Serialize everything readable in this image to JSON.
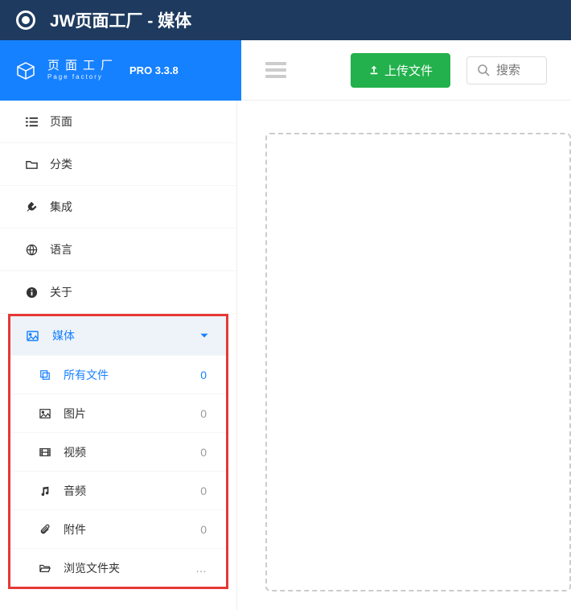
{
  "header": {
    "title": "JW页面工厂 - 媒体"
  },
  "brand": {
    "name_cn": "页面工厂",
    "name_en": "Page factory",
    "version": "PRO 3.3.8"
  },
  "toolbar": {
    "upload_label": "上传文件",
    "search_placeholder": "搜索"
  },
  "nav": {
    "items": [
      {
        "label": "页面"
      },
      {
        "label": "分类"
      },
      {
        "label": "集成"
      },
      {
        "label": "语言"
      },
      {
        "label": "关于"
      }
    ]
  },
  "media": {
    "header": "媒体",
    "items": [
      {
        "label": "所有文件",
        "count": "0",
        "active": true
      },
      {
        "label": "图片",
        "count": "0"
      },
      {
        "label": "视频",
        "count": "0"
      },
      {
        "label": "音频",
        "count": "0"
      },
      {
        "label": "附件",
        "count": "0"
      },
      {
        "label": "浏览文件夹",
        "count": "…"
      }
    ]
  }
}
